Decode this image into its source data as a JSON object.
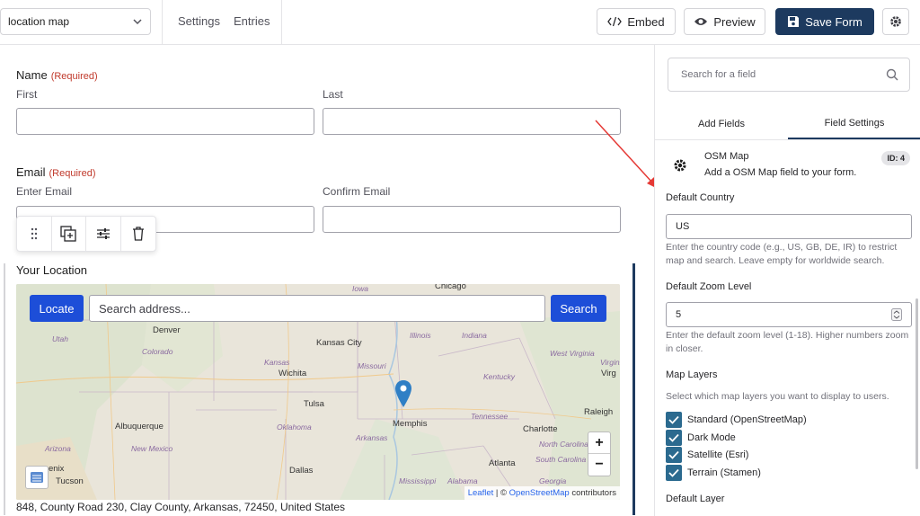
{
  "topbar": {
    "form_select": "location map",
    "links": [
      "Settings",
      "Entries"
    ],
    "embed_label": "Embed",
    "preview_label": "Preview",
    "save_label": "Save Form"
  },
  "form": {
    "name_label": "Name",
    "required": "(Required)",
    "first_label": "First",
    "last_label": "Last",
    "email_label": "Email",
    "enter_email_label": "Enter Email",
    "confirm_email_label": "Confirm Email",
    "location_label": "Your Location",
    "address": "848, County Road 230, Clay County, Arkansas, 72450, United States"
  },
  "map": {
    "locate_label": "Locate",
    "search_placeholder": "Search address...",
    "search_label": "Search",
    "zoom_in": "+",
    "zoom_out": "−",
    "attrib_leaflet": "Leaflet",
    "attrib_sep": " | © ",
    "attrib_osm": "OpenStreetMap",
    "attrib_contrib": " contributors",
    "cities": [
      "Denver",
      "Kansas City",
      "Wichita",
      "Tulsa",
      "Memphis",
      "Albuquerque",
      "Raleigh",
      "Charlotte",
      "Atlanta",
      "Dallas",
      "Tucson",
      "Chicago",
      "enix"
    ],
    "states": [
      "Iowa",
      "Utah",
      "Colorado",
      "Kansas",
      "Missouri",
      "Illinois",
      "Indiana",
      "Kentucky",
      "West Virginia",
      "Virginia",
      "Tennessee",
      "Oklahoma",
      "Arkansas",
      "North Carolina",
      "South Carolina",
      "New Mexico",
      "Arizona",
      "Mississippi",
      "Alabama",
      "Georgia"
    ]
  },
  "sidebar": {
    "search_placeholder": "Search for a field",
    "tabs": [
      "Add Fields",
      "Field Settings"
    ],
    "field_name": "OSM Map",
    "field_desc": "Add a OSM Map field to your form.",
    "field_id": "ID: 4",
    "default_country_label": "Default Country",
    "default_country_value": "US",
    "default_country_help": "Enter the country code (e.g., US, GB, DE, IR) to restrict map and search. Leave empty for worldwide search.",
    "zoom_label": "Default Zoom Level",
    "zoom_value": "5",
    "zoom_help": "Enter the default zoom level (1-18). Higher numbers zoom in closer.",
    "layers_label": "Map Layers",
    "layers_help": "Select which map layers you want to display to users.",
    "layers": [
      "Standard (OpenStreetMap)",
      "Dark Mode",
      "Satellite (Esri)",
      "Terrain (Stamen)"
    ],
    "default_layer_label": "Default Layer"
  },
  "colors": {
    "primary": "#1d3a5f",
    "map_button": "#1d4ed8",
    "required": "#c0392b",
    "checkbox": "#2b6a8f",
    "arrow": "#e53935"
  }
}
